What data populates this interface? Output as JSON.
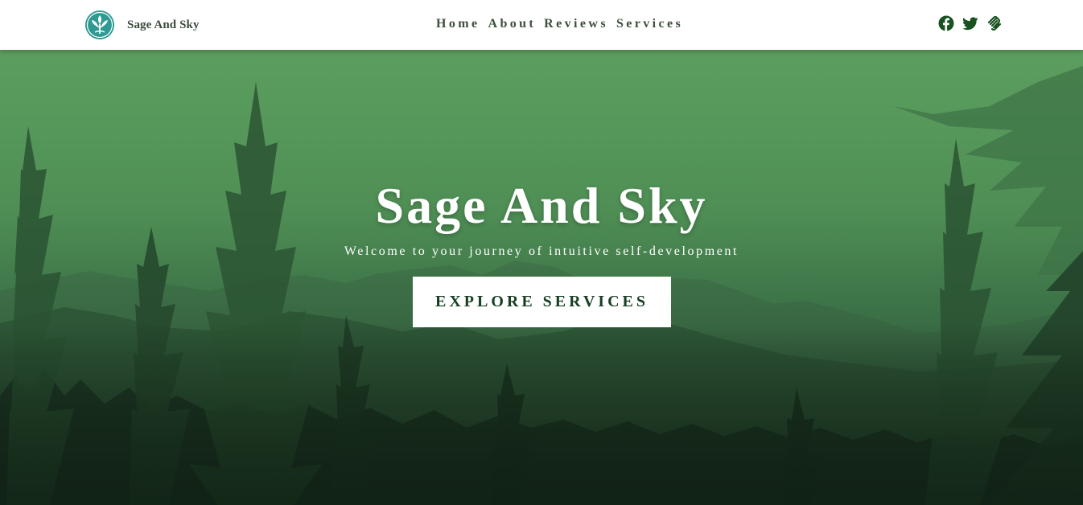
{
  "brand": {
    "name": "Sage And Sky",
    "logo_icon": "lotus-tree-icon",
    "logo_color": "#2f9a91"
  },
  "nav": {
    "links": [
      {
        "label": "Home"
      },
      {
        "label": "About"
      },
      {
        "label": "Reviews"
      },
      {
        "label": "Services"
      }
    ]
  },
  "social": {
    "icons": [
      "facebook-icon",
      "twitter-icon",
      "squarespace-icon"
    ],
    "color": "#17521f"
  },
  "hero": {
    "title": "Sage And Sky",
    "subtitle": "Welcome to your journey of intuitive self-development",
    "cta_label": "EXPLORE SERVICES",
    "background": "forest-mountains-green-overlay",
    "overlay_color": "#5a9e5f",
    "cta_text_color": "#183f22"
  }
}
